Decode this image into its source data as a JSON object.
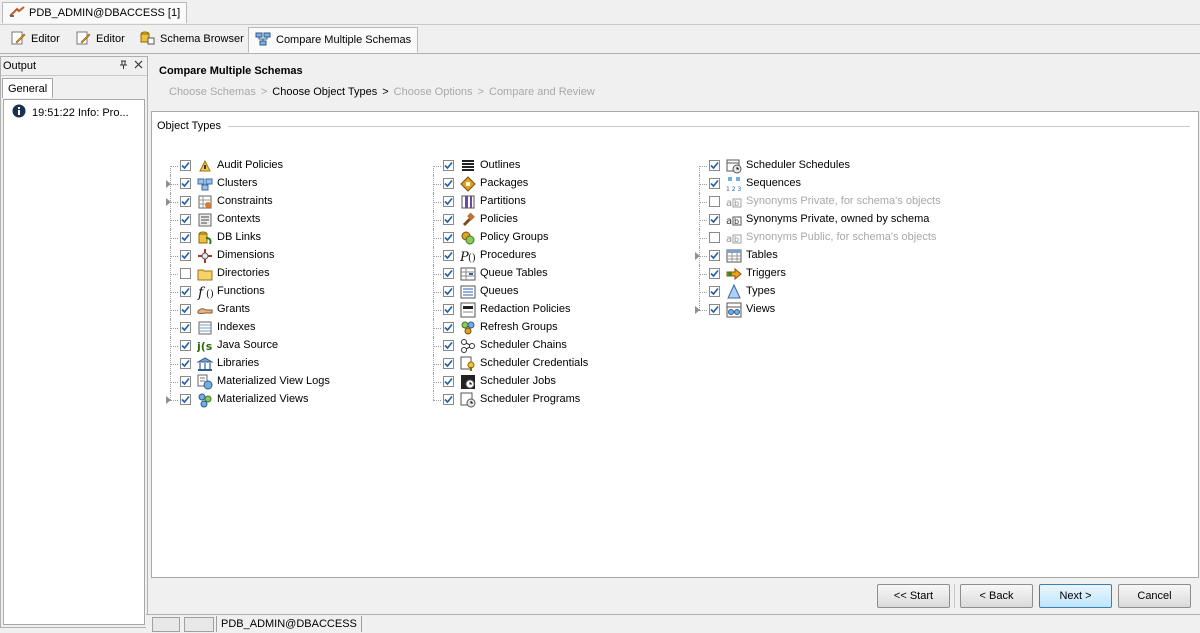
{
  "window": {
    "connection_tab": "PDB_ADMIN@DBACCESS [1]"
  },
  "toolbar": {
    "tabs": [
      {
        "label": "Editor",
        "icon": "editor-icon"
      },
      {
        "label": "Editor",
        "icon": "editor-icon"
      },
      {
        "label": "Schema Browser",
        "icon": "schema-browser-icon"
      },
      {
        "label": "Compare Multiple Schemas",
        "icon": "compare-schemas-icon",
        "active": true
      }
    ]
  },
  "output_panel": {
    "title": "Output",
    "tab": "General",
    "entries": [
      {
        "text": "19:51:22 Info: Pro...",
        "icon": "info-icon"
      }
    ]
  },
  "wizard": {
    "title": "Compare Multiple Schemas",
    "steps": [
      "Choose Schemas",
      "Choose Object Types",
      "Choose Options",
      "Compare and Review"
    ],
    "current_step": "Choose Object Types",
    "step_separator": ">",
    "group_label": "Object Types"
  },
  "object_types": {
    "col1": [
      {
        "label": "Audit Policies",
        "checked": true,
        "icon": "audit-policies-icon"
      },
      {
        "label": "Clusters",
        "checked": true,
        "expandable": true,
        "icon": "clusters-icon"
      },
      {
        "label": "Constraints",
        "checked": true,
        "expandable": true,
        "icon": "constraints-icon"
      },
      {
        "label": "Contexts",
        "checked": true,
        "icon": "contexts-icon"
      },
      {
        "label": "DB Links",
        "checked": true,
        "icon": "db-links-icon"
      },
      {
        "label": "Dimensions",
        "checked": true,
        "icon": "dimensions-icon"
      },
      {
        "label": "Directories",
        "checked": false,
        "icon": "directories-icon"
      },
      {
        "label": "Functions",
        "checked": true,
        "icon": "functions-icon"
      },
      {
        "label": "Grants",
        "checked": true,
        "icon": "grants-icon"
      },
      {
        "label": "Indexes",
        "checked": true,
        "icon": "indexes-icon"
      },
      {
        "label": "Java Source",
        "checked": true,
        "icon": "java-source-icon"
      },
      {
        "label": "Libraries",
        "checked": true,
        "icon": "libraries-icon"
      },
      {
        "label": "Materialized View Logs",
        "checked": true,
        "icon": "mview-logs-icon"
      },
      {
        "label": "Materialized Views",
        "checked": true,
        "expandable": true,
        "icon": "mviews-icon"
      }
    ],
    "col2": [
      {
        "label": "Outlines",
        "checked": true,
        "icon": "outlines-icon"
      },
      {
        "label": "Packages",
        "checked": true,
        "icon": "packages-icon"
      },
      {
        "label": "Partitions",
        "checked": true,
        "icon": "partitions-icon"
      },
      {
        "label": "Policies",
        "checked": true,
        "icon": "policies-icon"
      },
      {
        "label": "Policy Groups",
        "checked": true,
        "icon": "policy-groups-icon"
      },
      {
        "label": "Procedures",
        "checked": true,
        "icon": "procedures-icon"
      },
      {
        "label": "Queue Tables",
        "checked": true,
        "icon": "queue-tables-icon"
      },
      {
        "label": "Queues",
        "checked": true,
        "icon": "queues-icon"
      },
      {
        "label": "Redaction Policies",
        "checked": true,
        "icon": "redaction-policies-icon"
      },
      {
        "label": "Refresh Groups",
        "checked": true,
        "icon": "refresh-groups-icon"
      },
      {
        "label": "Scheduler Chains",
        "checked": true,
        "icon": "scheduler-chains-icon"
      },
      {
        "label": "Scheduler Credentials",
        "checked": true,
        "icon": "scheduler-credentials-icon"
      },
      {
        "label": "Scheduler Jobs",
        "checked": true,
        "icon": "scheduler-jobs-icon"
      },
      {
        "label": "Scheduler Programs",
        "checked": true,
        "icon": "scheduler-programs-icon"
      }
    ],
    "col3": [
      {
        "label": "Scheduler Schedules",
        "checked": true,
        "icon": "scheduler-schedules-icon"
      },
      {
        "label": "Sequences",
        "checked": true,
        "icon": "sequences-icon"
      },
      {
        "label": "Synonyms Private, for schema's objects",
        "checked": false,
        "disabled": true,
        "icon": "synonyms-icon"
      },
      {
        "label": "Synonyms Private, owned by schema",
        "checked": true,
        "icon": "synonyms-icon"
      },
      {
        "label": "Synonyms Public, for schema's objects",
        "checked": false,
        "disabled": true,
        "icon": "synonyms-icon"
      },
      {
        "label": "Tables",
        "checked": true,
        "expandable": true,
        "icon": "tables-icon"
      },
      {
        "label": "Triggers",
        "checked": true,
        "icon": "triggers-icon"
      },
      {
        "label": "Types",
        "checked": true,
        "icon": "types-icon"
      },
      {
        "label": "Views",
        "checked": true,
        "expandable": true,
        "icon": "views-icon"
      }
    ]
  },
  "buttons": {
    "start": "<< Start",
    "back": "< Back",
    "next": "Next >",
    "cancel": "Cancel"
  },
  "status_bar": {
    "connection": "PDB_ADMIN@DBACCESS"
  },
  "colors": {
    "accent": "#3c7fb1",
    "check": "#1f5fa8",
    "disabled_text": "#a8a8a8"
  }
}
